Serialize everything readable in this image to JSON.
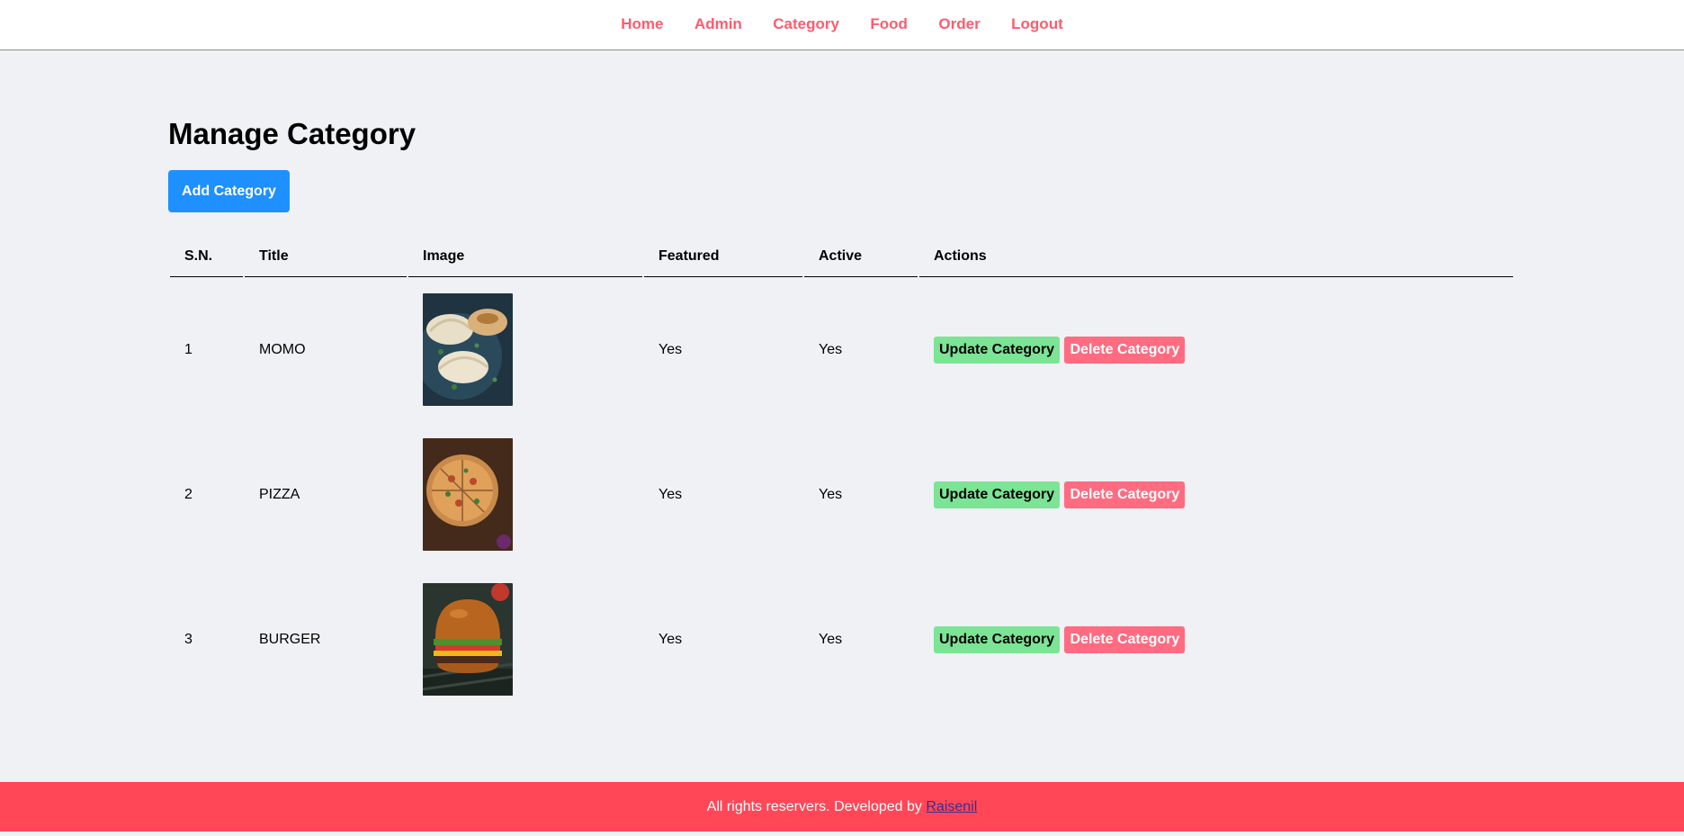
{
  "nav": {
    "items": [
      {
        "label": "Home"
      },
      {
        "label": "Admin"
      },
      {
        "label": "Category"
      },
      {
        "label": "Food"
      },
      {
        "label": "Order"
      },
      {
        "label": "Logout"
      }
    ]
  },
  "main": {
    "title": "Manage Category",
    "add_button": "Add Category"
  },
  "table": {
    "headers": [
      "S.N.",
      "Title",
      "Image",
      "Featured",
      "Active",
      "Actions"
    ],
    "rows": [
      {
        "sn": "1",
        "title": "MOMO",
        "image_icon": "momo-image",
        "featured": "Yes",
        "active": "Yes",
        "update": "Update Category",
        "delete": "Delete Category"
      },
      {
        "sn": "2",
        "title": "PIZZA",
        "image_icon": "pizza-image",
        "featured": "Yes",
        "active": "Yes",
        "update": "Update Category",
        "delete": "Delete Category"
      },
      {
        "sn": "3",
        "title": "BURGER",
        "image_icon": "burger-image",
        "featured": "Yes",
        "active": "Yes",
        "update": "Update Category",
        "delete": "Delete Category"
      }
    ]
  },
  "footer": {
    "text": "All rights reservers. Developed by ",
    "link": "Raisenil"
  },
  "colors": {
    "nav_link": "#ff5b6e",
    "background": "#f0f1f5",
    "add_button": "#1e90ff",
    "update_button": "#7be495",
    "delete_button": "#ff6b81",
    "footer": "#ff4757"
  }
}
